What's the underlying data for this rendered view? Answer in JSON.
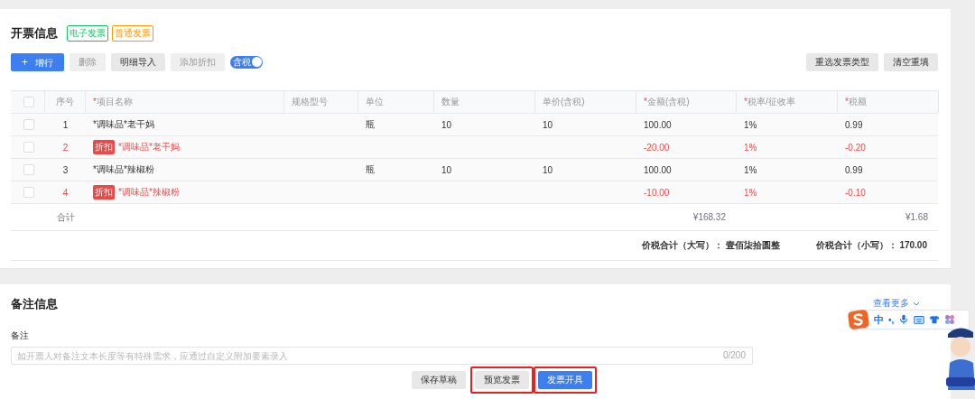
{
  "section_title": "开票信息",
  "invoice_tags": [
    {
      "label": "电子发票",
      "color": "#19be6b"
    },
    {
      "label": "普通发票",
      "color": "#ff9900"
    }
  ],
  "toolbar": [
    {
      "icon": "+",
      "label": "增行",
      "kind": "primary",
      "disabled": false
    },
    {
      "label": "删除",
      "kind": "default",
      "disabled": true
    },
    {
      "label": "明细导入",
      "kind": "default",
      "disabled": false
    },
    {
      "label": "添加折扣",
      "kind": "default",
      "disabled": true
    }
  ],
  "tax_toggle": {
    "label": "含税",
    "on": true
  },
  "right_buttons": [
    "重选发票类型",
    "清空重填"
  ],
  "table": {
    "select_all_checked": false,
    "columns": [
      {
        "label": "序号"
      },
      {
        "mark": "*",
        "label": "项目名称"
      },
      {
        "label": "规格型号"
      },
      {
        "label": "单位"
      },
      {
        "label": "数量"
      },
      {
        "label": "单价(含税)"
      },
      {
        "mark": "*",
        "label": "金额(含税)"
      },
      {
        "mark": "*",
        "label": "税率/征收率"
      },
      {
        "mark": "*",
        "label": "税额"
      }
    ],
    "rows": [
      {
        "kind": "item",
        "checked": false,
        "cells": [
          "1",
          "*调味品*老干妈",
          "",
          "瓶",
          "10",
          "10",
          "100.00",
          "1%",
          "0.99"
        ]
      },
      {
        "kind": "discount",
        "tag": "折扣",
        "checked": false,
        "cells": [
          "2",
          "*调味品*老干妈",
          "",
          "",
          "",
          "",
          "-20.00",
          "1%",
          "-0.20"
        ]
      },
      {
        "kind": "item",
        "checked": false,
        "cells": [
          "3",
          "*调味品*辣椒粉",
          "",
          "瓶",
          "10",
          "10",
          "100.00",
          "1%",
          "0.99"
        ]
      },
      {
        "kind": "discount",
        "tag": "折扣",
        "checked": false,
        "cells": [
          "4",
          "*调味品*辣椒粉",
          "",
          "",
          "",
          "",
          "-10.00",
          "1%",
          "-0.10"
        ]
      }
    ],
    "total": {
      "label": "合计",
      "amount": "¥168.32",
      "tax": "¥1.68"
    }
  },
  "summary": [
    {
      "label": "价税合计（大写）：",
      "value": "壹佰柒拾圆整"
    },
    {
      "label": "价税合计（小写）：",
      "value": "170.00"
    }
  ],
  "remarks": {
    "title": "备注信息",
    "more_link": "查看更多",
    "field_label": "备注",
    "placeholder": "如开票人对备注文本长度等有特殊需求，应通过自定义附加要素录入",
    "counter": "0/200"
  },
  "footer_buttons": [
    {
      "label": "保存草稿",
      "kind": "default",
      "highlighted": false
    },
    {
      "label": "预览发票",
      "kind": "default",
      "highlighted": true
    },
    {
      "label": "发票开具",
      "kind": "primary",
      "highlighted": true
    }
  ],
  "ime_toolbar": {
    "language": "中",
    "punctuation": "•,"
  }
}
